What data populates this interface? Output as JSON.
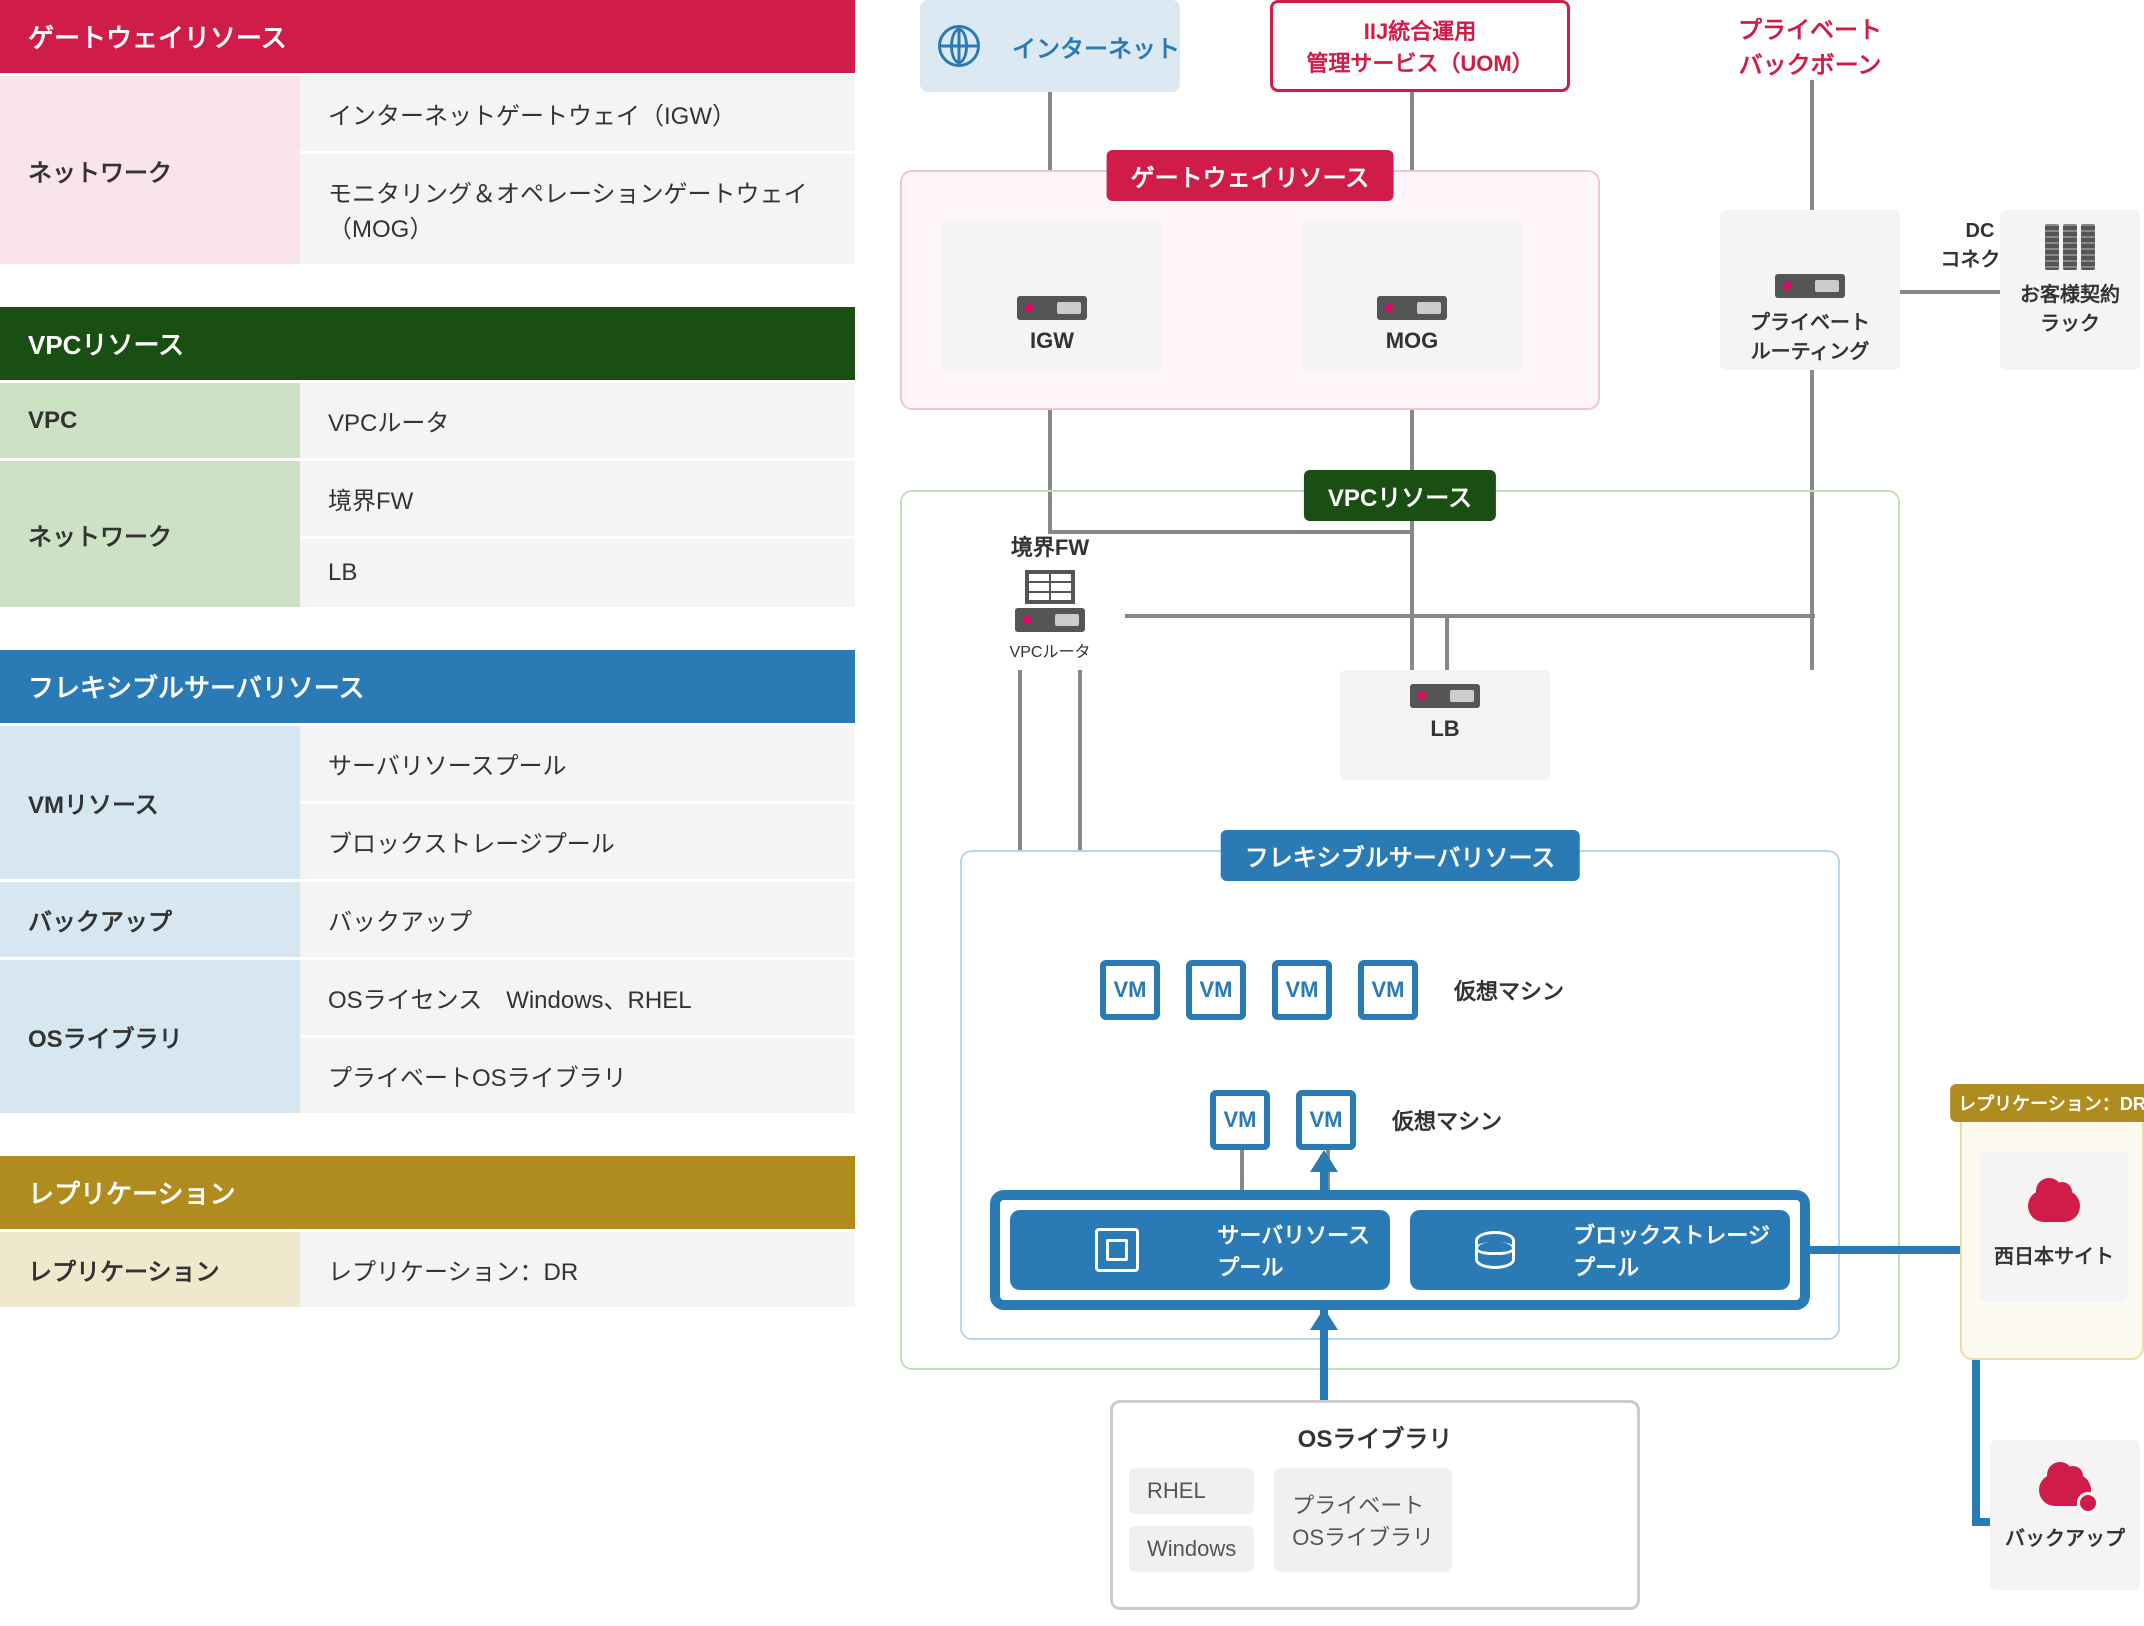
{
  "tables": {
    "gateway": {
      "title": "ゲートウェイリソース",
      "rows": [
        {
          "label": "ネットワーク",
          "items": [
            "インターネットゲートウェイ（IGW）",
            "モニタリング＆オペレーションゲートウェイ（MOG）"
          ]
        }
      ]
    },
    "vpc": {
      "title": "VPCリソース",
      "rows": [
        {
          "label": "VPC",
          "items": [
            "VPCルータ"
          ]
        },
        {
          "label": "ネットワーク",
          "items": [
            "境界FW",
            "LB"
          ]
        }
      ]
    },
    "flex": {
      "title": "フレキシブルサーバリソース",
      "rows": [
        {
          "label": "VMリソース",
          "items": [
            "サーバリソースプール",
            "ブロックストレージプール"
          ]
        },
        {
          "label": "バックアップ",
          "items": [
            "バックアップ"
          ]
        },
        {
          "label": "OSライブラリ",
          "items": [
            "OSライセンス　Windows、RHEL",
            "プライベートOSライブラリ"
          ]
        }
      ]
    },
    "replication": {
      "title": "レプリケーション",
      "rows": [
        {
          "label": "レプリケーション",
          "items": [
            "レプリケーション：DR"
          ]
        }
      ]
    }
  },
  "diagram": {
    "internet": "インターネット",
    "uom": {
      "line1": "IIJ統合運用",
      "line2": "管理サービス（UOM）"
    },
    "private_backbone": {
      "line1": "プライベート",
      "line2": "バックボーン"
    },
    "gateway_panel": "ゲートウェイリソース",
    "igw": "IGW",
    "mog": "MOG",
    "private_routing": {
      "line1": "プライベート",
      "line2": "ルーティング"
    },
    "dc_connector": {
      "line1": "DC",
      "line2": "コネクタ"
    },
    "customer_rack": {
      "line1": "お客様契約",
      "line2": "ラック"
    },
    "vpc_panel": "VPCリソース",
    "boundary_fw": "境界FW",
    "vpc_router": "VPCルータ",
    "lb": "LB",
    "flex_panel": "フレキシブルサーバリソース",
    "vm": "VM",
    "vm_label": "仮想マシン",
    "pool_server": {
      "line1": "サーバリソース",
      "line2": "プール"
    },
    "pool_block": {
      "line1": "ブロックストレージ",
      "line2": "プール"
    },
    "os_library": "OSライブラリ",
    "os_rhel": "RHEL",
    "os_windows": "Windows",
    "os_private": {
      "line1": "プライベート",
      "line2": "OSライブラリ"
    },
    "repl_panel": "レプリケーション：DR",
    "west_site": "西日本サイト",
    "backup": "バックアップ"
  }
}
